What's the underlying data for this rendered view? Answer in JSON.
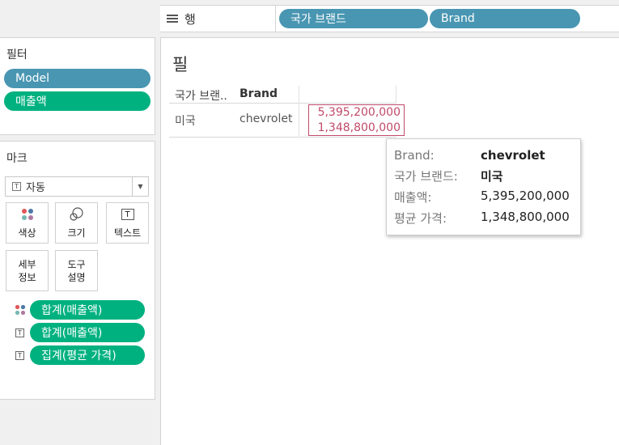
{
  "rows_shelf": {
    "label": "행",
    "pills": [
      "국가 브랜드",
      "Brand"
    ]
  },
  "filters": {
    "title": "필터",
    "pills": [
      "Model",
      "매출액"
    ]
  },
  "marks": {
    "title": "마크",
    "mark_type": "자동",
    "buttons": {
      "color": "색상",
      "size": "크기",
      "text": "텍스트",
      "detail_line1": "세부",
      "detail_line2": "정보",
      "tooltip_line1": "도구",
      "tooltip_line2": "설명"
    },
    "fields": [
      {
        "label": "합계(매출액)",
        "icon": "color-dots-icon"
      },
      {
        "label": "합계(매출액)",
        "icon": "text-icon"
      },
      {
        "label": "집계(평균 가격)",
        "icon": "text-icon"
      }
    ]
  },
  "view": {
    "title": "필",
    "headers": [
      "국가 브랜..",
      "Brand"
    ],
    "row": {
      "country": "미국",
      "brand": "chevrolet",
      "values": [
        "5,395,200,000",
        "1,348,800,000"
      ]
    }
  },
  "tooltip": {
    "rows": [
      {
        "key": "Brand:",
        "value": "chevrolet"
      },
      {
        "key": "국가 브랜드:",
        "value": "미국"
      },
      {
        "key": "매출액:",
        "value": "5,395,200,000"
      },
      {
        "key": "평균 가격:",
        "value": "1,348,800,000"
      }
    ]
  },
  "colors": {
    "dimension_pill": "#4996b2",
    "measure_pill": "#00b180",
    "highlight": "#c04a6a"
  }
}
